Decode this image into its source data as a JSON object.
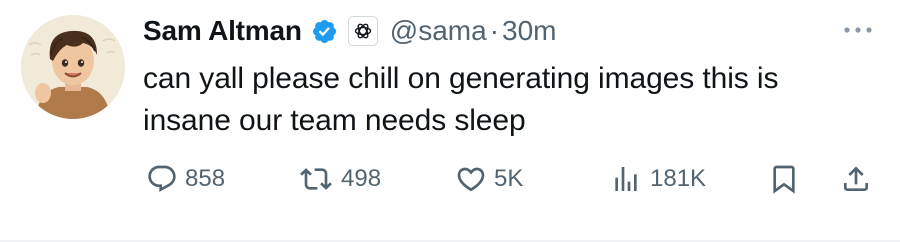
{
  "author": {
    "name": "Sam Altman",
    "handle": "@sama",
    "separator": "·",
    "time": "30m",
    "verified_color": "#1d9bf0"
  },
  "tweet": {
    "text": "can yall please chill on generating images this is insane our team needs sleep"
  },
  "actions": {
    "replies": {
      "icon": "reply-icon",
      "count": "858"
    },
    "retweets": {
      "icon": "retweet-icon",
      "count": "498"
    },
    "likes": {
      "icon": "heart-icon",
      "count": "5K"
    },
    "views": {
      "icon": "views-icon",
      "count": "181K"
    },
    "bookmark": {
      "icon": "bookmark-icon"
    },
    "share": {
      "icon": "share-icon"
    }
  },
  "colors": {
    "text": "#0f1419",
    "secondary": "#536471",
    "verified": "#1d9bf0"
  }
}
